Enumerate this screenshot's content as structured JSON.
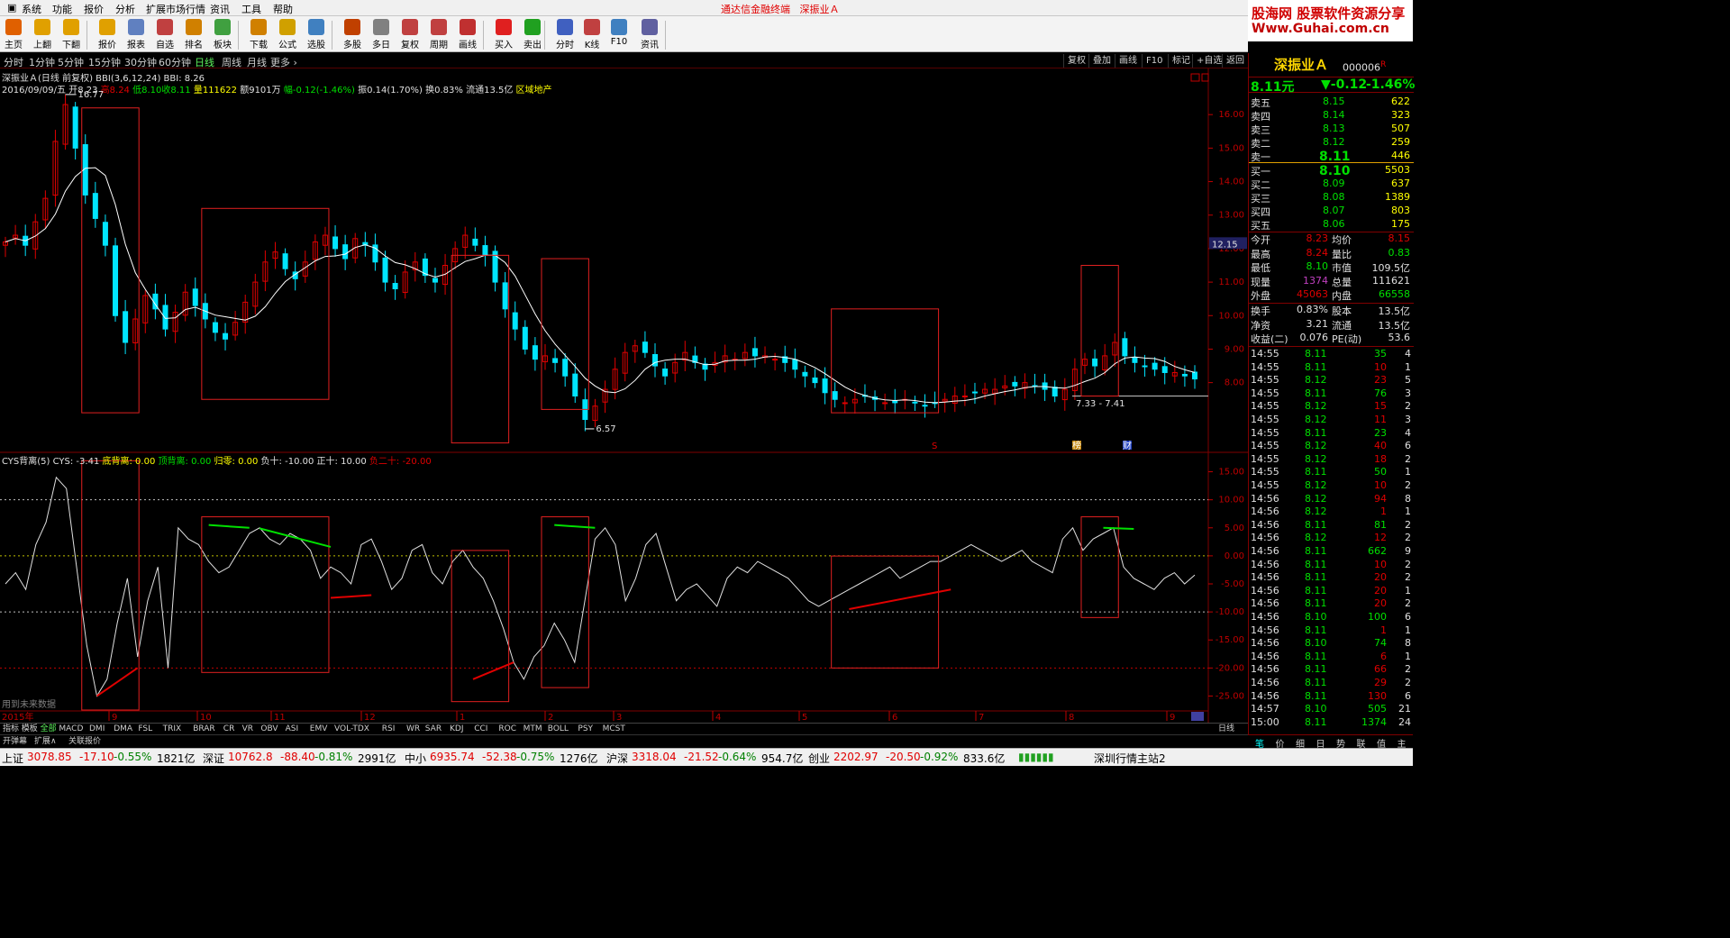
{
  "menu": {
    "items": [
      "系统",
      "功能",
      "报价",
      "分析",
      "扩展市场行情",
      "资讯",
      "工具",
      "帮助"
    ],
    "center_title": "通达信金融终端",
    "center_stock": "深振业Ａ",
    "logo_top": "股海网 股票软件资源分享",
    "logo_bottom": "Www.Guhai.com.cn"
  },
  "toolbar": [
    {
      "label": "主页",
      "icon": "home-icon",
      "color": "#e06000"
    },
    {
      "label": "上翻",
      "icon": "up-arrow-icon",
      "color": "#e0a000"
    },
    {
      "label": "下翻",
      "icon": "down-arrow-icon",
      "color": "#e0a000"
    },
    {
      "label": "报价",
      "icon": "yen-icon",
      "color": "#e0a000"
    },
    {
      "label": "报表",
      "icon": "report-icon",
      "color": "#6080c0"
    },
    {
      "label": "自选",
      "icon": "f6-icon",
      "color": "#c04040"
    },
    {
      "label": "排名",
      "icon": "ranking-icon",
      "color": "#d08000"
    },
    {
      "label": "板块",
      "icon": "sector-icon",
      "color": "#40a040"
    },
    {
      "label": "下载",
      "icon": "download-icon",
      "color": "#d08000"
    },
    {
      "label": "公式",
      "icon": "formula-icon",
      "color": "#d0a000"
    },
    {
      "label": "选股",
      "icon": "stock-picker-icon",
      "color": "#4080c0"
    },
    {
      "label": "多股",
      "icon": "multi-stock-icon",
      "color": "#c04000"
    },
    {
      "label": "多日",
      "icon": "multi-day-icon",
      "color": "#808080"
    },
    {
      "label": "复权",
      "icon": "adjust-icon",
      "color": "#c04040"
    },
    {
      "label": "周期",
      "icon": "f8-icon",
      "color": "#c04040"
    },
    {
      "label": "画线",
      "icon": "draw-line-icon",
      "color": "#c03030"
    },
    {
      "label": "买入",
      "icon": "buy-icon",
      "color": "#e02020"
    },
    {
      "label": "卖出",
      "icon": "sell-icon",
      "color": "#20a020"
    },
    {
      "label": "分时",
      "icon": "intraday-icon",
      "color": "#4060c0"
    },
    {
      "label": "K线",
      "icon": "kline-icon",
      "color": "#c04040"
    },
    {
      "label": "F10",
      "icon": "f10-icon",
      "color": "#4080c0"
    },
    {
      "label": "资讯",
      "icon": "news-icon",
      "color": "#6060a0"
    }
  ],
  "periods": [
    "分时",
    "1分钟",
    "5分钟",
    "15分钟",
    "30分钟",
    "60分钟",
    "日线",
    "周线",
    "月线",
    "更多 ›"
  ],
  "active_period": "日线",
  "right_buttons": [
    "复权",
    "叠加",
    "画线",
    "F10",
    "标记",
    "+自选",
    "返回"
  ],
  "chart_title": "深振业Ａ(日线 前复权) BBI(3,6,12,24) BBI: 8.26",
  "info": {
    "date": "2016/09/09/五",
    "open_label": "开",
    "open": "8.23",
    "high_label": "高",
    "high": "8.24",
    "low_label": "低",
    "low": "8.10",
    "close_label": "收",
    "close": "8.11",
    "vol_label": "量",
    "vol": "111622",
    "amount": "额9101万",
    "change": "幅-0.12(-1.46%)",
    "amplitude": "振0.14(1.70%)",
    "turnover": "换0.83%",
    "float": "流通13.5亿",
    "sector": "区域地产"
  },
  "indicator_legend": {
    "name": "CYS背离(5)",
    "cys": "CYS: -3.41",
    "bottom_div": "底背离: 0.00",
    "top_div": "顶背离: 0.00",
    "zero": "归零: 0.00",
    "neg10": "负十: -10.00",
    "pos10": "正十: 10.00",
    "neg20": "负二十: -20.00"
  },
  "future_data_note": "用到未来数据",
  "year_label": "2015年",
  "annotations": {
    "peak": "16.77",
    "trough": "6.57",
    "range": "7.33 - 7.41",
    "cursor_price": "12.15",
    "mark_s": "S",
    "mark_bang": "榜",
    "mark_cai": "财"
  },
  "chart_data": [
    {
      "type": "candlestick",
      "title": "深振业Ａ(日线 前复权)",
      "ylim": [
        6.0,
        17.0
      ],
      "yticks": [
        "16.00",
        "15.00",
        "14.00",
        "13.00",
        "12.00",
        "11.00",
        "10.00",
        "9.00",
        "8.00"
      ],
      "xticks": [
        "9",
        "10",
        "11",
        "12",
        "1",
        "2",
        "3",
        "4",
        "5",
        "6",
        "7",
        "8",
        "9"
      ],
      "close_series_approx": [
        12.2,
        12.4,
        12.1,
        12.8,
        13.5,
        15.2,
        16.3,
        15.0,
        13.6,
        12.9,
        12.1,
        10.0,
        9.2,
        9.9,
        10.6,
        10.2,
        9.6,
        10.1,
        10.7,
        10.3,
        9.9,
        9.5,
        9.3,
        9.8,
        10.4,
        11.0,
        11.6,
        11.9,
        11.4,
        11.1,
        11.6,
        12.2,
        12.4,
        12.0,
        11.7,
        12.3,
        12.1,
        11.6,
        11.0,
        10.8,
        11.3,
        11.6,
        11.2,
        11.0,
        11.5,
        12.0,
        12.4,
        12.1,
        11.8,
        11.0,
        10.2,
        9.6,
        9.0,
        8.7,
        8.8,
        8.6,
        8.2,
        7.6,
        6.9,
        7.3,
        7.8,
        8.4,
        8.9,
        9.1,
        8.9,
        8.5,
        8.2,
        8.6,
        8.9,
        8.6,
        8.4,
        8.6,
        8.8,
        8.7,
        8.9,
        8.8,
        8.8,
        8.7,
        8.6,
        8.4,
        8.2,
        8.0,
        7.7,
        7.5,
        7.4,
        7.5,
        7.6,
        7.5,
        7.4,
        7.4,
        7.5,
        7.4,
        7.3,
        7.4,
        7.5,
        7.6,
        7.6,
        7.7,
        7.8,
        7.8,
        7.9,
        7.9,
        8.0,
        7.9,
        7.8,
        7.6,
        7.8,
        8.4,
        8.7,
        8.5,
        8.8,
        9.2,
        8.8,
        8.6,
        8.5,
        8.4,
        8.3,
        8.3,
        8.2,
        8.11
      ],
      "series": [
        {
          "name": "BBI",
          "value": 8.26
        }
      ]
    },
    {
      "type": "line",
      "title": "CYS背离(5)",
      "ylim": [
        -27.5,
        17.5
      ],
      "yticks": [
        "15.00",
        "10.00",
        "5.00",
        "0.00",
        "-5.00",
        "-10.00",
        "-15.00",
        "-20.00",
        "-25.00"
      ],
      "reference_lines": [
        10,
        0,
        -10,
        -20
      ],
      "series": [
        {
          "name": "CYS",
          "values": [
            -5,
            -3,
            -6,
            2,
            6,
            14,
            12,
            -2,
            -16,
            -25,
            -22,
            -12,
            -4,
            -18,
            -8,
            -2,
            -20,
            5,
            3,
            2,
            -1,
            -3,
            -2,
            1,
            4,
            5,
            3,
            2,
            4,
            3,
            1,
            -4,
            -2,
            -3,
            -5,
            2,
            3,
            -1,
            -6,
            -4,
            1,
            2,
            -3,
            -5,
            -1,
            1,
            -2,
            -4,
            -8,
            -13,
            -19,
            -22,
            -18,
            -16,
            -12,
            -15,
            -19,
            -8,
            3,
            5,
            2,
            -8,
            -4,
            2,
            4,
            -2,
            -8,
            -6,
            -5,
            -7,
            -9,
            -4,
            -2,
            -3,
            -1,
            -2,
            -3,
            -4,
            -6,
            -8,
            -9,
            -8,
            -7,
            -6,
            -5,
            -4,
            -3,
            -2,
            -4,
            -3,
            -2,
            -1,
            -1,
            0,
            1,
            2,
            1,
            0,
            -1,
            0,
            1,
            -1,
            -2,
            -3,
            3,
            5,
            1,
            3,
            4,
            5,
            -2,
            -4,
            -5,
            -6,
            -4,
            -3,
            -5,
            -3.41
          ]
        }
      ]
    }
  ],
  "quote": {
    "name": "深振业Ａ",
    "code": "000006",
    "superscript": "R",
    "price": "8.11元",
    "change": "▼-0.12",
    "pct": "-1.46%",
    "asks": [
      {
        "label": "卖五",
        "price": "8.15",
        "vol": "622"
      },
      {
        "label": "卖四",
        "price": "8.14",
        "vol": "323"
      },
      {
        "label": "卖三",
        "price": "8.13",
        "vol": "507"
      },
      {
        "label": "卖二",
        "price": "8.12",
        "vol": "259"
      },
      {
        "label": "卖一",
        "price": "8.11",
        "vol": "446"
      }
    ],
    "bids": [
      {
        "label": "买一",
        "price": "8.10",
        "vol": "5503"
      },
      {
        "label": "买二",
        "price": "8.09",
        "vol": "637"
      },
      {
        "label": "买三",
        "price": "8.08",
        "vol": "1389"
      },
      {
        "label": "买四",
        "price": "8.07",
        "vol": "803"
      },
      {
        "label": "买五",
        "price": "8.06",
        "vol": "175"
      }
    ],
    "stats": [
      {
        "l1": "今开",
        "v1": "8.23",
        "c1": "#e00000",
        "l2": "均价",
        "v2": "8.15",
        "c2": "#e00000"
      },
      {
        "l1": "最高",
        "v1": "8.24",
        "c1": "#e00000",
        "l2": "量比",
        "v2": "0.83",
        "c2": "#00e000"
      },
      {
        "l1": "最低",
        "v1": "8.10",
        "c1": "#00e000",
        "l2": "市值",
        "v2": "109.5亿",
        "c2": "#e0e0e0"
      },
      {
        "l1": "现量",
        "v1": "1374",
        "c1": "#c040c0",
        "l2": "总量",
        "v2": "111621",
        "c2": "#e0e0e0"
      },
      {
        "l1": "外盘",
        "v1": "45063",
        "c1": "#e00000",
        "l2": "内盘",
        "v2": "66558",
        "c2": "#00e000"
      }
    ],
    "stats2": [
      {
        "l1": "换手",
        "v1": "0.83%",
        "l2": "股本",
        "v2": "13.5亿"
      },
      {
        "l1": "净资",
        "v1": "3.21",
        "l2": "流通",
        "v2": "13.5亿"
      },
      {
        "l1": "收益(二)",
        "v1": "0.076",
        "l2": "PE(动)",
        "v2": "53.6"
      }
    ],
    "ticks": [
      {
        "t": "14:55",
        "p": "8.11",
        "v": "35",
        "n": "4",
        "pc": "#00e000",
        "vc": "#00e000"
      },
      {
        "t": "14:55",
        "p": "8.11",
        "v": "10",
        "n": "1",
        "pc": "#00e000",
        "vc": "#e00000"
      },
      {
        "t": "14:55",
        "p": "8.12",
        "v": "23",
        "n": "5",
        "pc": "#00e000",
        "vc": "#e00000"
      },
      {
        "t": "14:55",
        "p": "8.11",
        "v": "76",
        "n": "3",
        "pc": "#00e000",
        "vc": "#00e000"
      },
      {
        "t": "14:55",
        "p": "8.12",
        "v": "15",
        "n": "2",
        "pc": "#00e000",
        "vc": "#e00000"
      },
      {
        "t": "14:55",
        "p": "8.12",
        "v": "11",
        "n": "3",
        "pc": "#00e000",
        "vc": "#e00000"
      },
      {
        "t": "14:55",
        "p": "8.11",
        "v": "23",
        "n": "4",
        "pc": "#00e000",
        "vc": "#00e000"
      },
      {
        "t": "14:55",
        "p": "8.12",
        "v": "40",
        "n": "6",
        "pc": "#00e000",
        "vc": "#e00000"
      },
      {
        "t": "14:55",
        "p": "8.12",
        "v": "18",
        "n": "2",
        "pc": "#00e000",
        "vc": "#e00000"
      },
      {
        "t": "14:55",
        "p": "8.11",
        "v": "50",
        "n": "1",
        "pc": "#00e000",
        "vc": "#00e000"
      },
      {
        "t": "14:55",
        "p": "8.12",
        "v": "10",
        "n": "2",
        "pc": "#00e000",
        "vc": "#e00000"
      },
      {
        "t": "14:56",
        "p": "8.12",
        "v": "94",
        "n": "8",
        "pc": "#00e000",
        "vc": "#e00000"
      },
      {
        "t": "14:56",
        "p": "8.12",
        "v": "1",
        "n": "1",
        "pc": "#00e000",
        "vc": "#e00000"
      },
      {
        "t": "14:56",
        "p": "8.11",
        "v": "81",
        "n": "2",
        "pc": "#00e000",
        "vc": "#00e000"
      },
      {
        "t": "14:56",
        "p": "8.12",
        "v": "12",
        "n": "2",
        "pc": "#00e000",
        "vc": "#e00000"
      },
      {
        "t": "14:56",
        "p": "8.11",
        "v": "662",
        "n": "9",
        "pc": "#00e000",
        "vc": "#00e000"
      },
      {
        "t": "14:56",
        "p": "8.11",
        "v": "10",
        "n": "2",
        "pc": "#00e000",
        "vc": "#e00000"
      },
      {
        "t": "14:56",
        "p": "8.11",
        "v": "20",
        "n": "2",
        "pc": "#00e000",
        "vc": "#e00000"
      },
      {
        "t": "14:56",
        "p": "8.11",
        "v": "20",
        "n": "1",
        "pc": "#00e000",
        "vc": "#e00000"
      },
      {
        "t": "14:56",
        "p": "8.11",
        "v": "20",
        "n": "2",
        "pc": "#00e000",
        "vc": "#e00000"
      },
      {
        "t": "14:56",
        "p": "8.10",
        "v": "100",
        "n": "6",
        "pc": "#00e000",
        "vc": "#00e000"
      },
      {
        "t": "14:56",
        "p": "8.11",
        "v": "1",
        "n": "1",
        "pc": "#00e000",
        "vc": "#e00000"
      },
      {
        "t": "14:56",
        "p": "8.10",
        "v": "74",
        "n": "8",
        "pc": "#00e000",
        "vc": "#00e000"
      },
      {
        "t": "14:56",
        "p": "8.11",
        "v": "6",
        "n": "1",
        "pc": "#00e000",
        "vc": "#e00000"
      },
      {
        "t": "14:56",
        "p": "8.11",
        "v": "66",
        "n": "2",
        "pc": "#00e000",
        "vc": "#e00000"
      },
      {
        "t": "14:56",
        "p": "8.11",
        "v": "29",
        "n": "2",
        "pc": "#00e000",
        "vc": "#e00000"
      },
      {
        "t": "14:56",
        "p": "8.11",
        "v": "130",
        "n": "6",
        "pc": "#00e000",
        "vc": "#e00000"
      },
      {
        "t": "14:57",
        "p": "8.10",
        "v": "505",
        "n": "21",
        "pc": "#00e000",
        "vc": "#00e000"
      },
      {
        "t": "15:00",
        "p": "8.11",
        "v": "1374",
        "n": "24",
        "pc": "#00e000",
        "vc": "#00e000"
      }
    ],
    "tabs": [
      "笔",
      "价",
      "细",
      "日",
      "势",
      "联",
      "值",
      "主"
    ]
  },
  "indicator_tabs": [
    "指标",
    "模板",
    "全部",
    "MACD",
    "DMI",
    "DMA",
    "FSL",
    "TRIX",
    "BRAR",
    "CR",
    "VR",
    "OBV",
    "ASI",
    "EMV",
    "VOL-TDX",
    "RSI",
    "WR",
    "SAR",
    "KDJ",
    "CCI",
    "ROC",
    "MTM",
    "BOLL",
    "PSY",
    "MCST"
  ],
  "indicator_tab_selected": "全部",
  "sub_tabs": [
    "开弹幕",
    "扩展∧",
    "关联报价"
  ],
  "day_label": "日线",
  "status": [
    {
      "name": "上证",
      "val": "3078.85",
      "chg": "-17.10",
      "pct": "-0.55%",
      "amt": "1821亿"
    },
    {
      "name": "深证",
      "val": "10762.8",
      "chg": "-88.40",
      "pct": "-0.81%",
      "amt": "2991亿"
    },
    {
      "name": "中小",
      "val": "6935.74",
      "chg": "-52.38",
      "pct": "-0.75%",
      "amt": "1276亿"
    },
    {
      "name": "沪深",
      "val": "3318.04",
      "chg": "-21.52",
      "pct": "-0.64%",
      "amt": "954.7亿"
    },
    {
      "name": "创业",
      "val": "2202.97",
      "chg": "-20.50",
      "pct": "-0.92%",
      "amt": "833.6亿"
    }
  ],
  "server": "深圳行情主站2",
  "colors": {
    "up": "#e00000",
    "down": "#00e5ff",
    "box": "#e02020",
    "bbi": "#ffffff"
  }
}
